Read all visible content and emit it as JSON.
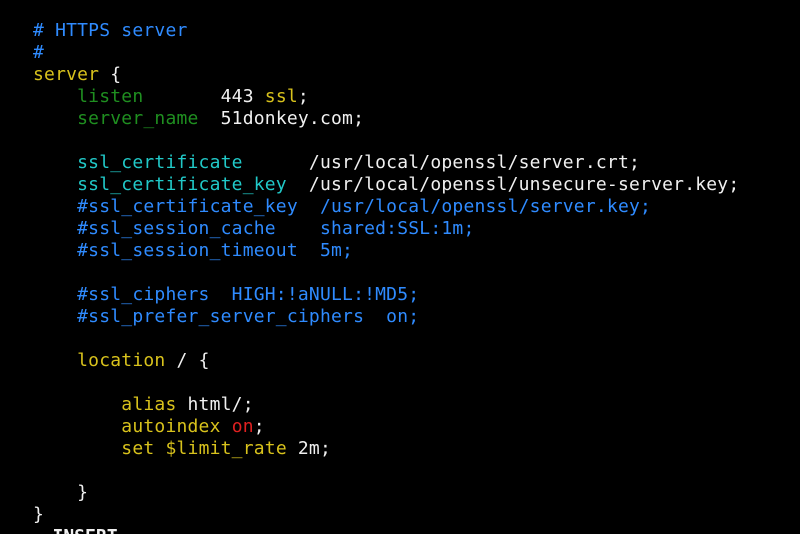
{
  "colors": {
    "background": "#000000",
    "comment": "#2f8bff",
    "keyword": "#d8c21c",
    "directive_green": "#1f8f20",
    "directive_cyan": "#21c9c8",
    "text": "#f0f0f0",
    "value_red": "#e02020"
  },
  "lines": [
    [
      {
        "t": "# HTTPS server",
        "c": "blue"
      }
    ],
    [
      {
        "t": "#",
        "c": "blue"
      }
    ],
    [
      {
        "t": "server",
        "c": "yellow"
      },
      {
        "t": " {",
        "c": "white"
      }
    ],
    [
      {
        "t": "    listen",
        "c": "green"
      },
      {
        "t": "       443 ",
        "c": "white"
      },
      {
        "t": "ssl",
        "c": "yellow"
      },
      {
        "t": ";",
        "c": "white"
      }
    ],
    [
      {
        "t": "    server_name",
        "c": "green"
      },
      {
        "t": "  51donkey.com;",
        "c": "white"
      }
    ],
    [],
    [
      {
        "t": "    ssl_certificate",
        "c": "cyan"
      },
      {
        "t": "      /usr/local/openssl/server.crt;",
        "c": "white"
      }
    ],
    [
      {
        "t": "    ssl_certificate_key",
        "c": "cyan"
      },
      {
        "t": "  /usr/local/openssl/unsecure-server.key;",
        "c": "white"
      }
    ],
    [
      {
        "t": "    #ssl_certificate_key  /usr/local/openssl/server.key;",
        "c": "blue"
      }
    ],
    [
      {
        "t": "    #ssl_session_cache    shared:SSL:1m;",
        "c": "blue"
      }
    ],
    [
      {
        "t": "    #ssl_session_timeout  5m;",
        "c": "blue"
      }
    ],
    [],
    [
      {
        "t": "    #ssl_ciphers  HIGH:!aNULL:!MD5;",
        "c": "blue"
      }
    ],
    [
      {
        "t": "    #ssl_prefer_server_ciphers  on;",
        "c": "blue"
      }
    ],
    [],
    [
      {
        "t": "    location",
        "c": "yellow"
      },
      {
        "t": " / {",
        "c": "white"
      }
    ],
    [],
    [
      {
        "t": "        alias",
        "c": "yellow"
      },
      {
        "t": " html/;",
        "c": "white"
      }
    ],
    [
      {
        "t": "        autoindex",
        "c": "yellow"
      },
      {
        "t": " ",
        "c": "white"
      },
      {
        "t": "on",
        "c": "red"
      },
      {
        "t": ";",
        "c": "white"
      }
    ],
    [
      {
        "t": "        set",
        "c": "yellow"
      },
      {
        "t": " ",
        "c": "white"
      },
      {
        "t": "$limit_rate",
        "c": "yellow"
      },
      {
        "t": " 2m;",
        "c": "white"
      }
    ],
    [],
    [
      {
        "t": "    }",
        "c": "white"
      }
    ],
    [
      {
        "t": "}",
        "c": "white"
      }
    ]
  ],
  "status": "-- INSERT --"
}
